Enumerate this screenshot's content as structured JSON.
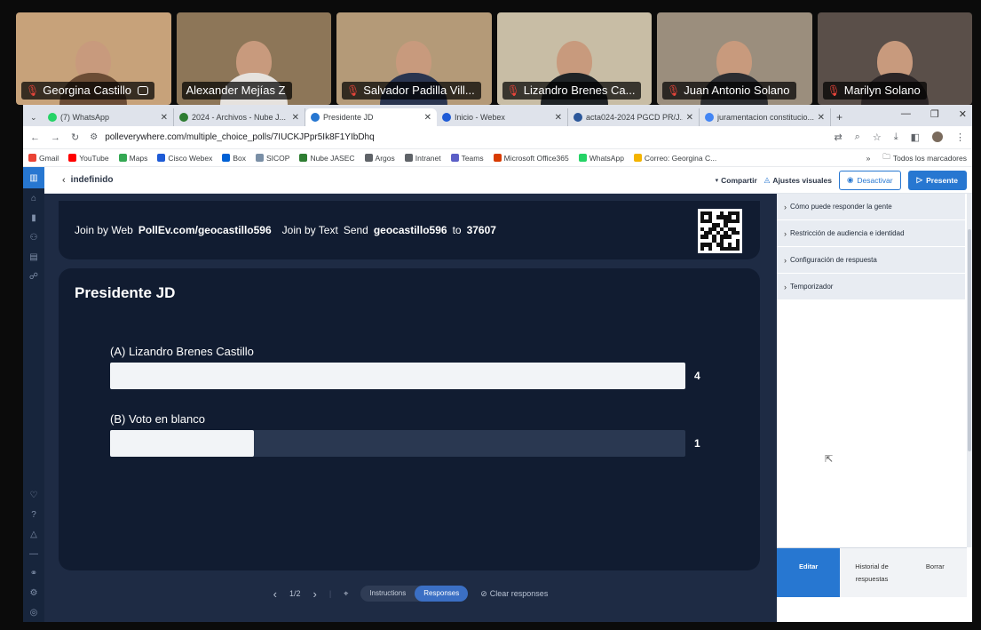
{
  "meeting": {
    "participants": [
      {
        "name": "Georgina Castillo",
        "muted": true,
        "has_badge": true,
        "bg": "#c7a27a",
        "torso": "#6b4c35"
      },
      {
        "name": "Alexander Mejías Z",
        "muted": false,
        "has_badge": false,
        "bg": "#8d7658",
        "torso": "#e6e2de"
      },
      {
        "name": "Salvador Padilla Vill...",
        "muted": true,
        "has_badge": false,
        "bg": "#b49a78",
        "torso": "#2a3550"
      },
      {
        "name": "Lizandro Brenes Ca...",
        "muted": true,
        "has_badge": false,
        "bg": "#c8bda5",
        "torso": "#1f2326"
      },
      {
        "name": "Juan Antonio  Solano",
        "muted": true,
        "has_badge": false,
        "bg": "#9b8e7d",
        "torso": "#2c2d31"
      },
      {
        "name": "Marilyn Solano",
        "muted": true,
        "has_badge": false,
        "bg": "#5a4f49",
        "torso": "#2b2526"
      }
    ]
  },
  "browser": {
    "tabs": [
      {
        "title": "(7) WhatsApp",
        "color": "#25d366",
        "active": false
      },
      {
        "title": "2024 - Archivos - Nube J...",
        "color": "#2e7d32",
        "active": false
      },
      {
        "title": "Presidente JD",
        "color": "#2777d1",
        "active": true
      },
      {
        "title": "Inicio - Webex",
        "color": "#1e5bd6",
        "active": false
      },
      {
        "title": "acta024-2024 PGCD PR/J...",
        "color": "#2b579a",
        "active": false
      },
      {
        "title": "juramentacion constitucio...",
        "color": "#4285f4",
        "active": false
      }
    ],
    "new_tab": "+",
    "url": "polleverywhere.com/multiple_choice_polls/7IUCKJPpr5Ik8F1YIbDhq",
    "bookmarks": [
      {
        "label": "Gmail",
        "color": "#ea4335"
      },
      {
        "label": "YouTube",
        "color": "#ff0000"
      },
      {
        "label": "Maps",
        "color": "#34a853"
      },
      {
        "label": "Cisco Webex",
        "color": "#1e5bd6"
      },
      {
        "label": "Box",
        "color": "#0061d5"
      },
      {
        "label": "SICOP",
        "color": "#7a8fa6"
      },
      {
        "label": "Nube JASEC",
        "color": "#2e7d32"
      },
      {
        "label": "Argos",
        "color": "#5f6368"
      },
      {
        "label": "Intranet",
        "color": "#5f6368"
      },
      {
        "label": "Teams",
        "color": "#5b5fc7"
      },
      {
        "label": "Microsoft Office365",
        "color": "#d83b01"
      },
      {
        "label": "WhatsApp",
        "color": "#25d366"
      },
      {
        "label": "Correo: Georgina C...",
        "color": "#f4b400"
      }
    ],
    "bookmarks_more": "»",
    "all_bookmarks": "Todos los marcadores"
  },
  "app": {
    "poll_name": "indefinido",
    "share_label": "Compartir",
    "visual_label": "Ajustes visuales",
    "deactivate_label": "Desactivar",
    "present_label": "Presente",
    "join": {
      "web_prefix": "Join by Web",
      "web_url": "PollEv.com/geocastillo596",
      "text_prefix": "Join by Text",
      "send_word": "Send",
      "code": "geocastillo596",
      "to_word": "to",
      "number": "37607"
    },
    "question": "Presidente JD",
    "options": [
      {
        "label": "(A) Lizandro Brenes Castillo",
        "count": "4",
        "share": 1.0
      },
      {
        "label": "(B) Voto en blanco",
        "count": "1",
        "share": 0.25
      }
    ],
    "pager": "1/2",
    "instructions_label": "Instructions",
    "responses_label": "Responses",
    "clear_label": "Clear responses",
    "panel": {
      "sections": [
        "Cómo puede responder la gente",
        "Restricción de audiencia e identidad",
        "Configuración de respuesta",
        "Temporizador"
      ],
      "edit_label": "Editar",
      "history_label_1": "Historial de",
      "history_label_2": "respuestas",
      "delete_label": "Borrar"
    }
  }
}
